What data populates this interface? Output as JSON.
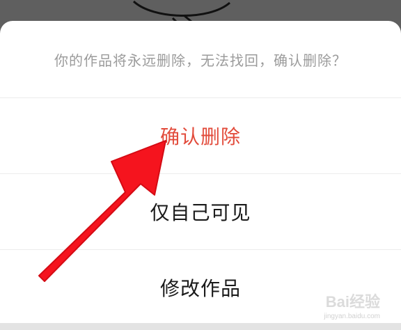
{
  "dialog": {
    "prompt": "你的作品将永远删除，无法找回，确认删除？",
    "options": [
      {
        "label": "确认删除",
        "style": "danger"
      },
      {
        "label": "仅自己可见",
        "style": "normal"
      },
      {
        "label": "修改作品",
        "style": "normal"
      }
    ]
  },
  "annotation": {
    "arrow_icon": "red-arrow-icon",
    "color": "#f5141e"
  },
  "watermark": {
    "logo": "Bai经验",
    "url": "jingyan.baidu.com"
  },
  "colors": {
    "danger": "#e24b3b",
    "text": "#1a1a1a",
    "muted": "#9b9b9b",
    "overlay": "#5f5f5f"
  }
}
